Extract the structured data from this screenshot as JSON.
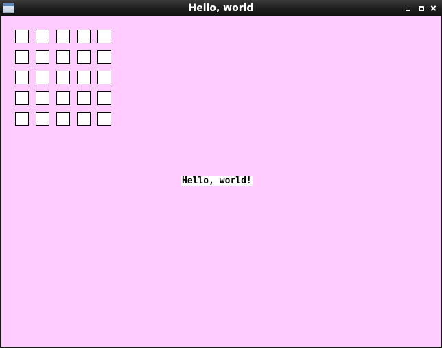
{
  "window": {
    "title": "Hello, world",
    "background_color": "#ffccff",
    "title_icon": "window-app-icon",
    "controls": [
      "minimize-icon",
      "maximize-icon",
      "close-icon"
    ]
  },
  "grid": {
    "rows": 5,
    "columns": 5,
    "box_fill": "#ffffff",
    "box_border": "#000000"
  },
  "content": {
    "message": "Hello, world!"
  }
}
